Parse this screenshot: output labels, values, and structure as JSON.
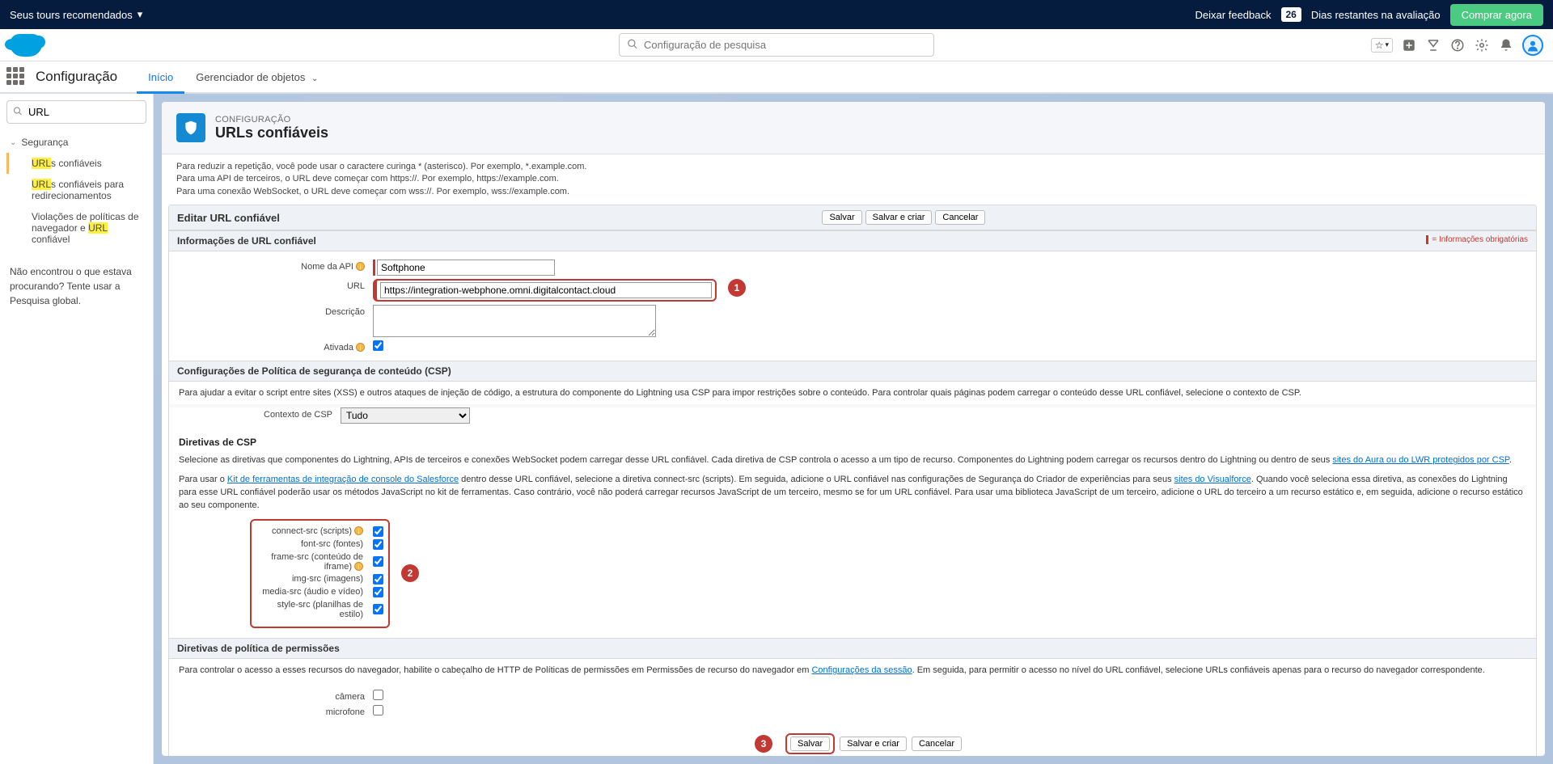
{
  "topBanner": {
    "recommended": "Seus tours recomendados",
    "feedback": "Deixar feedback",
    "trialDays": "26",
    "trialText": "Dias restantes na avaliação",
    "buyNow": "Comprar agora"
  },
  "header": {
    "searchPlaceholder": "Configuração de pesquisa"
  },
  "tabs": {
    "appTitle": "Configuração",
    "home": "Início",
    "objectManager": "Gerenciador de objetos"
  },
  "sidebar": {
    "searchValue": "URL",
    "section": "Segurança",
    "items": {
      "trusted": {
        "pre": "URL",
        "post": "s confiáveis"
      },
      "redirect": {
        "pre": "URL",
        "mid": "s confiáveis para redirecionamentos"
      },
      "violations": {
        "pre": "Violações de políticas de navegador e ",
        "hl": "URL",
        "post": " confiável"
      }
    },
    "helpText": "Não encontrou o que estava procurando? Tente usar a Pesquisa global."
  },
  "page": {
    "sup": "CONFIGURAÇÃO",
    "title": "URLs confiáveis"
  },
  "intro": {
    "l1": "Para reduzir a repetição, você pode usar o caractere curinga * (asterisco). Por exemplo, *.example.com.",
    "l2": "Para uma API de terceiros, o URL deve começar com https://. Por exemplo, https://example.com.",
    "l3": "Para uma conexão WebSocket, o URL deve começar com wss://. Por exemplo, wss://example.com."
  },
  "pane": {
    "editTitle": "Editar URL confiável",
    "save": "Salvar",
    "saveAndCreate": "Salvar e criar",
    "cancel": "Cancelar"
  },
  "sections": {
    "info": "Informações de URL confiável",
    "required": "= Informações obrigatórias",
    "csp": "Configurações de Política de segurança de conteúdo (CSP)",
    "permissions": "Diretivas de política de permissões"
  },
  "form": {
    "apiNameLabel": "Nome da API",
    "apiNameValue": "Softphone",
    "urlLabel": "URL",
    "urlValue": "https://integration-webphone.omni.digitalcontact.cloud",
    "descLabel": "Descrição",
    "descValue": "",
    "activeLabel": "Ativada"
  },
  "csp": {
    "desc": "Para ajudar a evitar o script entre sites (XSS) e outros ataques de injeção de código, a estrutura do componente do Lightning usa CSP para impor restrições sobre o conteúdo. Para controlar quais páginas podem carregar o conteúdo desse URL confiável, selecione o contexto de CSP.",
    "contextLabel": "Contexto de CSP",
    "contextValue": "Tudo",
    "directivesHeader": "Diretivas de CSP",
    "selectText1": "Selecione as diretivas que componentes do Lightning, APIs de terceiros e conexões WebSocket podem carregar desse URL confiável. Cada diretiva de CSP controla o acesso a um tipo de recurso. Componentes do Lightning podem carregar os recursos dentro do Lightning ou dentro de seus ",
    "selectLink1": "sites do Aura ou do LWR protegidos por CSP",
    "selectText2Pre": "Para usar o ",
    "toolkitLink": "Kit de ferramentas de integração de console do Salesforce",
    "selectText2Mid": " dentro desse URL confiável, selecione a diretiva connect-src (scripts). Em seguida, adicione o URL confiável nas configurações de Segurança do Criador de experiências para seus ",
    "vfLink": "sites do Visualforce",
    "selectText2Post": ". Quando você seleciona essa diretiva, as conexões do Lightning para esse URL confiável poderão usar os métodos JavaScript no kit de ferramentas. Caso contrário, você não poderá carregar recursos JavaScript de um terceiro, mesmo se for um URL confiável. Para usar uma biblioteca JavaScript de um terceiro, adicione o URL do terceiro a um recurso estático e, em seguida, adicione o recurso estático ao seu componente."
  },
  "directives": {
    "connect": "connect-src (scripts)",
    "font": "font-src (fontes)",
    "frame": "frame-src (conteúdo de iframe)",
    "img": "img-src (imagens)",
    "media": "media-src (áudio e vídeo)",
    "style": "style-src (planilhas de estilo)"
  },
  "permissions": {
    "textPre": "Para controlar o acesso a esses recursos do navegador, habilite o cabeçalho de HTTP de Políticas de permissões em Permissões de recurso do navegador em ",
    "link": "Configurações da sessão",
    "textPost": ". Em seguida, para permitir o acesso no nível do URL confiável, selecione URLs confiáveis apenas para o recurso do navegador correspondente.",
    "camera": "câmera",
    "microphone": "microfone"
  },
  "callouts": {
    "c1": "1",
    "c2": "2",
    "c3": "3"
  }
}
